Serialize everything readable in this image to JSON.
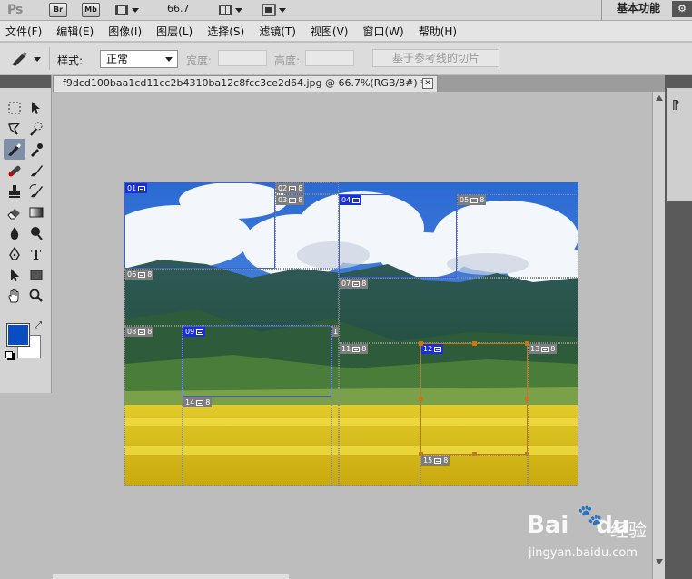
{
  "appbar": {
    "logo": "Ps",
    "bridge_label": "Br",
    "minibridge_label": "Mb",
    "zoom": "66.7",
    "workspace": "基本功能"
  },
  "menu": [
    "文件(F)",
    "编辑(E)",
    "图像(I)",
    "图层(L)",
    "选择(S)",
    "滤镜(T)",
    "视图(V)",
    "窗口(W)",
    "帮助(H)"
  ],
  "options": {
    "style_label": "样式:",
    "style_value": "正常",
    "width_label": "宽度:",
    "height_label": "高度:",
    "guides_button": "基于参考线的切片"
  },
  "document": {
    "tab_title": "f9dcd100baa1cd11cc2b4310ba12c8fcc3ce2d64.jpg @ 66.7%(RGB/8#) *",
    "close_glyph": "✕"
  },
  "colors": {
    "foreground": "#0a4dbf",
    "background": "#ffffff",
    "user_slice": "#3b5fe0",
    "selected_slice": "#c47a10"
  },
  "slices": [
    {
      "id": "01",
      "kind": "user",
      "badge": ""
    },
    {
      "id": "02",
      "kind": "auto",
      "badge": "8"
    },
    {
      "id": "03",
      "kind": "auto",
      "badge": "8"
    },
    {
      "id": "04",
      "kind": "user",
      "badge": ""
    },
    {
      "id": "05",
      "kind": "auto",
      "badge": "8"
    },
    {
      "id": "06",
      "kind": "auto",
      "badge": "8"
    },
    {
      "id": "07",
      "kind": "auto",
      "badge": "8"
    },
    {
      "id": "08",
      "kind": "auto",
      "badge": "8"
    },
    {
      "id": "09",
      "kind": "user",
      "badge": ""
    },
    {
      "id": "1",
      "kind": "auto",
      "badge": ""
    },
    {
      "id": "11",
      "kind": "auto",
      "badge": "8"
    },
    {
      "id": "12",
      "kind": "sel",
      "badge": ""
    },
    {
      "id": "13",
      "kind": "auto",
      "badge": "8"
    },
    {
      "id": "14",
      "kind": "auto",
      "badge": "8"
    },
    {
      "id": "15",
      "kind": "auto",
      "badge": "8"
    }
  ],
  "watermark": {
    "brand": "Bai",
    "brand2": "du",
    "cn": "经验",
    "url": "jingyan.baidu.com"
  }
}
